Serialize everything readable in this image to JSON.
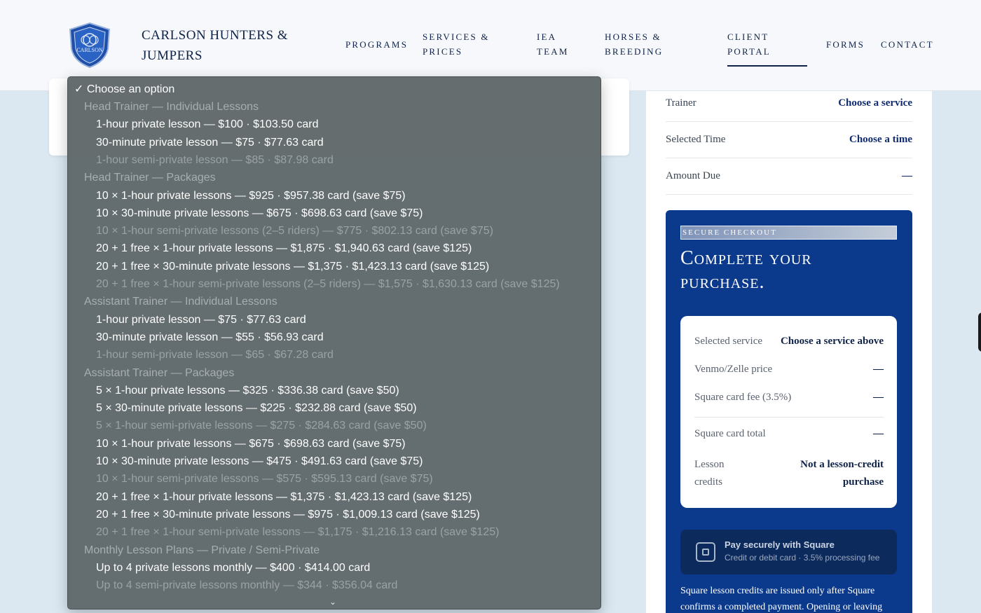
{
  "header": {
    "brand_line1": "CARLSON HUNTERS &",
    "brand_line2": "JUMPERS",
    "logo_text": "CARLSON",
    "nav": [
      {
        "line1": "PROGRAMS",
        "line2": ""
      },
      {
        "line1": "SERVICES &",
        "line2": "PRICES"
      },
      {
        "line1": "IEA",
        "line2": "TEAM"
      },
      {
        "line1": "HORSES &",
        "line2": "BREEDING"
      },
      {
        "line1": "CLIENT",
        "line2": "PORTAL"
      },
      {
        "line1": "FORMS",
        "line2": ""
      },
      {
        "line1": "CONTACT",
        "line2": ""
      }
    ],
    "active_nav": "CLIENT PORTAL"
  },
  "summary": {
    "rows": [
      {
        "label": "Trainer",
        "value": "Choose a service"
      },
      {
        "label": "Selected Time",
        "value": "Choose a time"
      },
      {
        "label": "Amount Due",
        "value": "—"
      }
    ]
  },
  "checkout": {
    "eyebrow": "SECURE CHECKOUT",
    "title": "Complete your purchase.",
    "rows": [
      {
        "label": "Selected service",
        "value": "Choose a service above"
      },
      {
        "label": "Venmo/Zelle price",
        "value": "—"
      },
      {
        "label": "Square card fee (3.5%)",
        "value": "—"
      },
      {
        "label": "Square card total",
        "value": "—"
      },
      {
        "label": "Lesson credits",
        "value": "Not a lesson-credit purchase"
      }
    ],
    "pay_button": {
      "title": "Pay securely with Square",
      "subtitle": "Credit or debit card · 3.5% processing fee"
    },
    "note": "Square lesson credits are issued only after Square confirms a completed payment. Opening or leaving"
  },
  "dropdown": {
    "selected": "✓ Choose an option",
    "options": [
      {
        "type": "group",
        "label": "Head Trainer — Individual Lessons"
      },
      {
        "type": "item",
        "label": "1-hour private lesson — $100 · $103.50 card"
      },
      {
        "type": "item",
        "label": "30-minute private lesson — $75 · $77.63 card"
      },
      {
        "type": "disabled",
        "label": "1-hour semi-private lesson — $85 · $87.98 card"
      },
      {
        "type": "group",
        "label": "Head Trainer — Packages"
      },
      {
        "type": "item",
        "label": "10 × 1-hour private lessons — $925 · $957.38 card (save $75)"
      },
      {
        "type": "item",
        "label": "10 × 30-minute private lessons — $675 · $698.63 card (save $75)"
      },
      {
        "type": "disabled",
        "label": "10 × 1-hour semi-private lessons (2–5 riders) — $775 · $802.13 card (save $75)"
      },
      {
        "type": "item",
        "label": "20 + 1 free × 1-hour private lessons — $1,875 · $1,940.63 card (save $125)"
      },
      {
        "type": "item",
        "label": "20 + 1 free × 30-minute private lessons — $1,375 · $1,423.13 card (save $125)"
      },
      {
        "type": "disabled",
        "label": "20 + 1 free × 1-hour semi-private lessons (2–5 riders) — $1,575 · $1,630.13 card (save $125)"
      },
      {
        "type": "group",
        "label": "Assistant Trainer — Individual Lessons"
      },
      {
        "type": "item",
        "label": "1-hour private lesson — $75 · $77.63 card"
      },
      {
        "type": "item",
        "label": "30-minute private lesson — $55 · $56.93 card"
      },
      {
        "type": "disabled",
        "label": "1-hour semi-private lesson — $65 · $67.28 card"
      },
      {
        "type": "group",
        "label": "Assistant Trainer — Packages"
      },
      {
        "type": "item",
        "label": "5 × 1-hour private lessons — $325 · $336.38 card (save $50)"
      },
      {
        "type": "item",
        "label": "5 × 30-minute private lessons — $225 · $232.88 card (save $50)"
      },
      {
        "type": "disabled",
        "label": "5 × 1-hour semi-private lessons — $275 · $284.63 card (save $50)"
      },
      {
        "type": "item",
        "label": "10 × 1-hour private lessons — $675 · $698.63 card (save $75)"
      },
      {
        "type": "item",
        "label": "10 × 30-minute private lessons — $475 · $491.63 card (save $75)"
      },
      {
        "type": "disabled",
        "label": "10 × 1-hour semi-private lessons — $575 · $595.13 card (save $75)"
      },
      {
        "type": "item",
        "label": "20 + 1 free × 1-hour private lessons — $1,375 · $1,423.13 card (save $125)"
      },
      {
        "type": "item",
        "label": "20 + 1 free × 30-minute private lessons — $975 · $1,009.13 card (save $125)"
      },
      {
        "type": "disabled",
        "label": "20 + 1 free × 1-hour semi-private lessons — $1,175 · $1,216.13 card (save $125)"
      },
      {
        "type": "group",
        "label": "Monthly Lesson Plans — Private / Semi-Private"
      },
      {
        "type": "item",
        "label": "Up to 4 private lessons monthly — $400 · $414.00 card"
      },
      {
        "type": "disabled",
        "label": "Up to 4 semi-private lessons monthly — $344 · $356.04 card"
      }
    ],
    "scroll_indicator": "⌄"
  }
}
